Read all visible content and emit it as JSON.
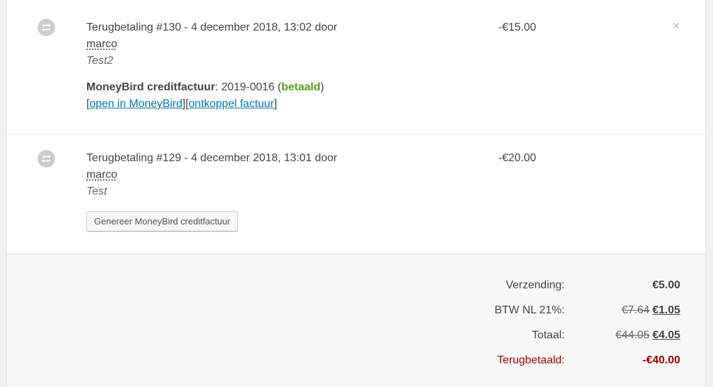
{
  "refunds": [
    {
      "title": "Terugbetaling #130 - 4 december 2018, 13:02 door",
      "author": "marco",
      "reason": "Test2",
      "amount": "-€15.00",
      "moneybird": {
        "label": "MoneyBird creditfactuur",
        "number": ": 2019-0016 (",
        "status": "betaald",
        "close_paren": ")",
        "link_open_left": "[",
        "link_open": "open in MoneyBird",
        "link_sep": "][",
        "link_detach": "ontkoppel factuur",
        "link_close_right": "]"
      },
      "delete_icon": "×"
    },
    {
      "title": "Terugbetaling #129 - 4 december 2018, 13:01 door",
      "author": "marco",
      "reason": "Test",
      "amount": "-€20.00",
      "generate_button": "Genereer MoneyBird creditfactuur"
    }
  ],
  "icons": {
    "refund": "refund-arrows-icon",
    "delete": "close-icon"
  },
  "totals": {
    "shipping": {
      "label": "Verzending:",
      "value": "€5.00"
    },
    "tax": {
      "label": "BTW NL 21%:",
      "old": "€7.64",
      "new": "€1.05"
    },
    "total": {
      "label": "Totaal:",
      "old": "€44.05",
      "new": "€4.05"
    },
    "refunded": {
      "label": "Terugbetaald:",
      "value": "-€40.00"
    }
  },
  "colors": {
    "paid": "#5a9e1b",
    "link": "#0073aa",
    "refunded": "#a00000"
  }
}
